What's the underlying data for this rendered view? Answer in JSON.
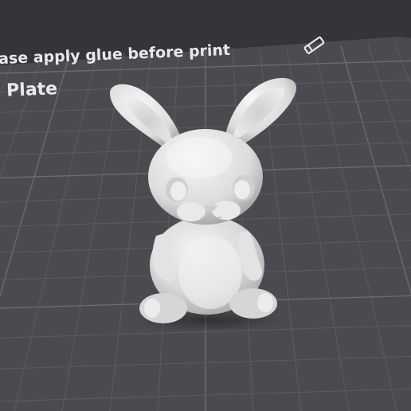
{
  "viewport": {
    "background": "#34353a",
    "plate_color": "#4a4b50",
    "grid_color": "#5c5d62",
    "grid_major_color": "#6a6b70"
  },
  "plate": {
    "notice": "ase apply glue before print",
    "edit_icon": "pencil-icon",
    "name": "Plate"
  },
  "model": {
    "name": "bunny-figure",
    "color": "#e6e6e6"
  }
}
